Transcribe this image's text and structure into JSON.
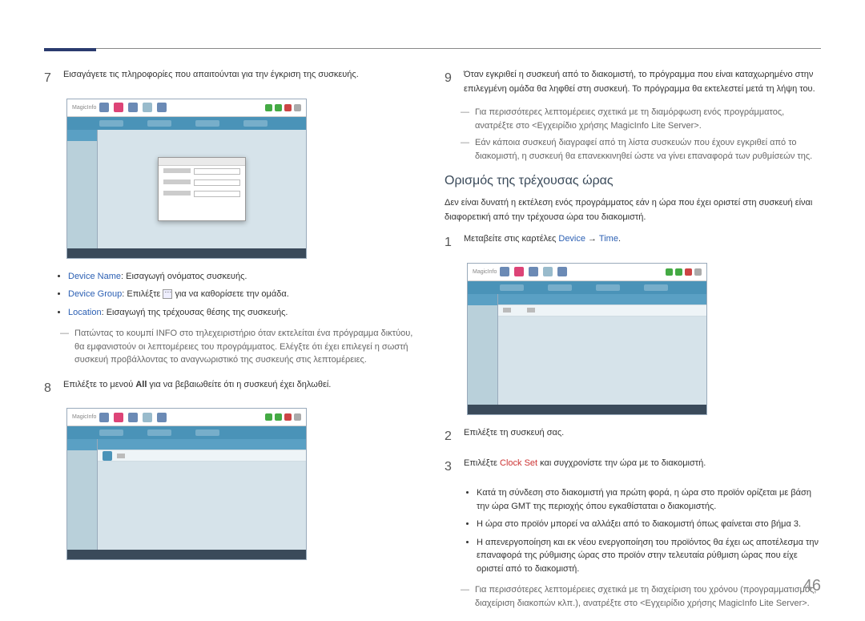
{
  "page_number": "46",
  "left": {
    "step7": "Εισαγάγετε τις πληροφορίες που απαιτούνται για την έγκριση της συσκευής.",
    "bullets": {
      "b1_label": "Device Name",
      "b1_text": ": Εισαγωγή ονόματος συσκευής.",
      "b2_label": "Device Group",
      "b2_pre": ": Επιλέξτε ",
      "b2_post": " για να καθορίσετε την ομάδα.",
      "b3_label": "Location",
      "b3_text": ": Εισαγωγή της τρέχουσας θέσης της συσκευής."
    },
    "dash1": "Πατώντας το κουμπί INFO στο τηλεχειριστήριο όταν εκτελείται ένα πρόγραμμα δικτύου, θα εμφανιστούν οι λεπτομέρειες του προγράμματος. Ελέγξτε ότι έχει επιλεγεί η σωστή συσκευή προβάλλοντας το αναγνωριστικό της συσκευής στις λεπτομέρειες.",
    "step8_pre": "Επιλέξτε το μενού ",
    "step8_all": "All",
    "step8_post": " για να βεβαιωθείτε ότι η συσκευή έχει δηλωθεί."
  },
  "right": {
    "step9": "Όταν εγκριθεί η συσκευή από το διακομιστή, το πρόγραμμα που είναι καταχωρημένο στην επιλεγμένη ομάδα θα ληφθεί στη συσκευή. Το πρόγραμμα θα εκτελεστεί μετά τη λήψη του.",
    "dash_a": "Για περισσότερες λεπτομέρειες σχετικά με τη διαμόρφωση ενός προγράμματος, ανατρέξτε στο <Εγχειρίδιο χρήσης MagicInfo Lite Server>.",
    "dash_b": "Εάν κάποια συσκευή διαγραφεί από τη λίστα συσκευών που έχουν εγκριθεί από το διακομιστή, η συσκευή θα επανεκκινηθεί ώστε να γίνει επαναφορά των ρυθμίσεών της.",
    "section_title": "Ορισμός της τρέχουσας ώρας",
    "section_intro": "Δεν είναι δυνατή η εκτέλεση ενός προγράμματος εάν η ώρα που έχει οριστεί στη συσκευή είναι διαφορετική από την τρέχουσα ώρα του διακομιστή.",
    "step1_pre": "Μεταβείτε στις καρτέλες ",
    "step1_device": "Device",
    "step1_arrow": " → ",
    "step1_time": "Time",
    "step1_post": ".",
    "step2": "Επιλέξτε τη συσκευή σας.",
    "step3_pre": "Επιλέξτε ",
    "step3_clock": "Clock Set",
    "step3_post": " και συγχρονίστε την ώρα με το διακομιστή.",
    "sub_bullets": {
      "s1": "Κατά τη σύνδεση στο διακομιστή για πρώτη φορά, η ώρα στο προϊόν ορίζεται με βάση την ώρα GMT της περιοχής όπου εγκαθίσταται ο διακομιστής.",
      "s2": "Η ώρα στο προϊόν μπορεί να αλλάξει από το διακομιστή όπως φαίνεται στο βήμα 3.",
      "s3": "Η απενεργοποίηση και εκ νέου ενεργοποίηση του προϊόντος θα έχει ως αποτέλεσμα την επαναφορά της ρύθμισης ώρας στο προϊόν στην τελευταία ρύθμιση ώρας που είχε οριστεί από το διακομιστή."
    },
    "dash_final": "Για περισσότερες λεπτομέρειες σχετικά με τη διαχείριση του χρόνου (προγραμματισμός, διαχείριση διακοπών κλπ.), ανατρέξτε στο <Εγχειρίδιο χρήσης MagicInfo Lite Server>."
  },
  "ss_logo": "MagicInfo"
}
